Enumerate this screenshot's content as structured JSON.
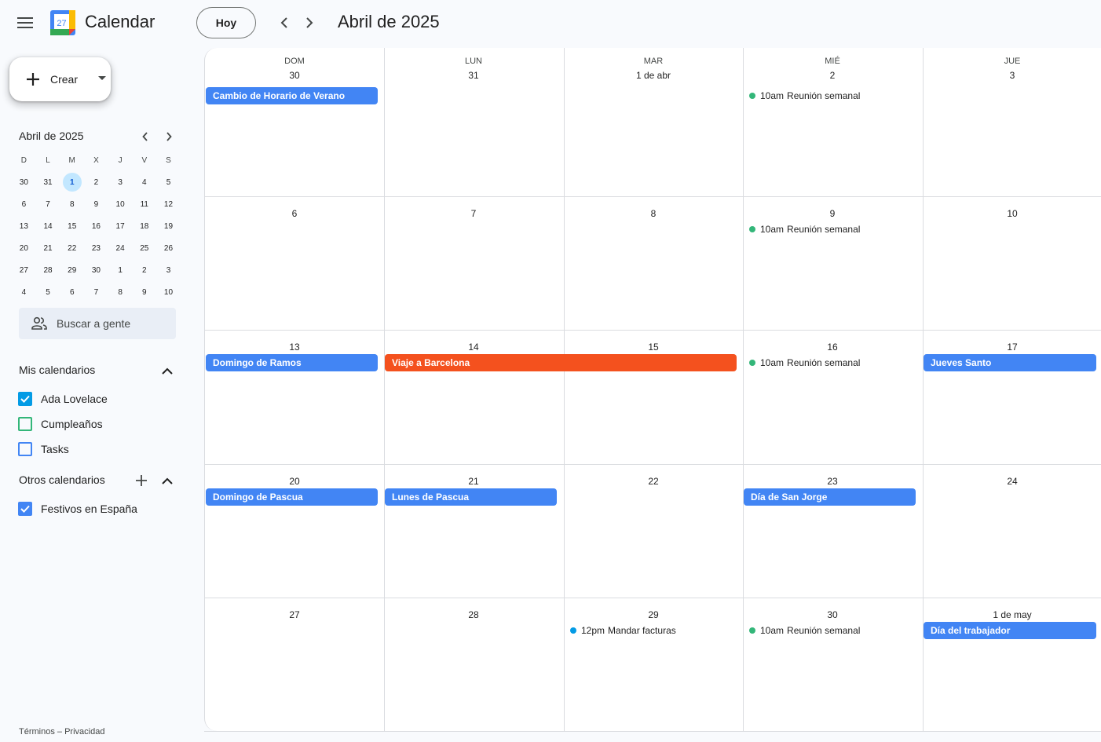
{
  "header": {
    "app_name": "Calendar",
    "logo_day": "27",
    "today_label": "Hoy",
    "period": "Abril de 2025",
    "icons": [
      "menu-icon",
      "calendar-logo-icon",
      "chevron-left-icon",
      "chevron-right-icon"
    ]
  },
  "sidebar": {
    "create_label": "Crear",
    "mini": {
      "title": "Abril de 2025",
      "weekdays": [
        "D",
        "L",
        "M",
        "X",
        "J",
        "V",
        "S"
      ],
      "weeks": [
        [
          "30",
          "31",
          "1",
          "2",
          "3",
          "4",
          "5"
        ],
        [
          "6",
          "7",
          "8",
          "9",
          "10",
          "11",
          "12"
        ],
        [
          "13",
          "14",
          "15",
          "16",
          "17",
          "18",
          "19"
        ],
        [
          "20",
          "21",
          "22",
          "23",
          "24",
          "25",
          "26"
        ],
        [
          "27",
          "28",
          "29",
          "30",
          "1",
          "2",
          "3"
        ],
        [
          "4",
          "5",
          "6",
          "7",
          "8",
          "9",
          "10"
        ]
      ],
      "selected": "1"
    },
    "search_people": "Buscar a gente",
    "my_calendars": {
      "title": "Mis calendarios",
      "items": [
        {
          "name": "Ada Lovelace",
          "color": "#039be5",
          "checked": true
        },
        {
          "name": "Cumpleaños",
          "color": "#33b679",
          "checked": false
        },
        {
          "name": "Tasks",
          "color": "#4285f4",
          "checked": false
        }
      ]
    },
    "other_calendars": {
      "title": "Otros calendarios",
      "items": [
        {
          "name": "Festivos en España",
          "color": "#4285f4",
          "checked": true
        }
      ]
    },
    "footer": {
      "terms": "Términos",
      "sep": " – ",
      "privacy": "Privacidad"
    }
  },
  "grid": {
    "weekdays": [
      "DOM",
      "LUN",
      "MAR",
      "MIÉ",
      "JUE"
    ],
    "weeks": [
      [
        "30",
        "31",
        "1 de abr",
        "2",
        "3"
      ],
      [
        "6",
        "7",
        "8",
        "9",
        "10"
      ],
      [
        "13",
        "14",
        "15",
        "16",
        "17"
      ],
      [
        "20",
        "21",
        "22",
        "23",
        "24"
      ],
      [
        "27",
        "28",
        "29",
        "30",
        "1 de may"
      ]
    ],
    "colors": {
      "holiday": "#4285f4",
      "trip": "#f4511e",
      "meeting_dot": "#33b679",
      "task_dot": "#039be5"
    },
    "chips": [
      {
        "week": 0,
        "col": 0,
        "span": 1,
        "title": "Cambio de Horario de Verano",
        "color": "#4285f4"
      },
      {
        "week": 2,
        "col": 0,
        "span": 1,
        "title": "Domingo de Ramos",
        "color": "#4285f4"
      },
      {
        "week": 2,
        "col": 1,
        "span": 2,
        "title": "Viaje a Barcelona",
        "color": "#f4511e"
      },
      {
        "week": 2,
        "col": 4,
        "span": 1,
        "title": "Jueves Santo",
        "color": "#4285f4"
      },
      {
        "week": 3,
        "col": 0,
        "span": 1,
        "title": "Domingo de Pascua",
        "color": "#4285f4"
      },
      {
        "week": 3,
        "col": 1,
        "span": 1,
        "title": "Lunes de Pascua",
        "color": "#4285f4"
      },
      {
        "week": 3,
        "col": 3,
        "span": 1,
        "title": "Día de San Jorge",
        "color": "#4285f4"
      },
      {
        "week": 4,
        "col": 4,
        "span": 1,
        "title": "Día del trabajador",
        "color": "#4285f4"
      }
    ],
    "timed": [
      {
        "week": 0,
        "col": 3,
        "time": "10am",
        "title": "Reunión semanal",
        "color": "#33b679"
      },
      {
        "week": 1,
        "col": 3,
        "time": "10am",
        "title": "Reunión semanal",
        "color": "#33b679"
      },
      {
        "week": 2,
        "col": 3,
        "time": "10am",
        "title": "Reunión semanal",
        "color": "#33b679"
      },
      {
        "week": 4,
        "col": 2,
        "time": "12pm",
        "title": "Mandar facturas",
        "color": "#039be5"
      },
      {
        "week": 4,
        "col": 3,
        "time": "10am",
        "title": "Reunión semanal",
        "color": "#33b679"
      }
    ]
  }
}
